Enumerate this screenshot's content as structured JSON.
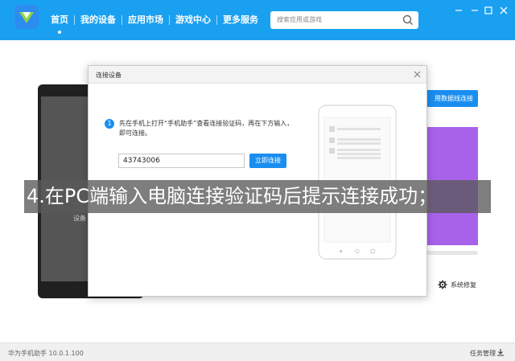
{
  "app": {
    "nav": [
      "首页",
      "我的设备",
      "应用市场",
      "游戏中心",
      "更多服务"
    ],
    "active_nav_index": 0,
    "search_placeholder": "搜索应用或游戏",
    "version": "华为手机助手 10.0.1.100",
    "task_manager": "任务管理"
  },
  "background": {
    "phone_caption": "设备",
    "usb_button": "用数据线连接",
    "repair_label": "系统修复"
  },
  "dialog": {
    "title": "连接设备",
    "step_number": "1",
    "instruction": "先在手机上打开“手机助手”查看连接验证码，再在下方输入，即可连接。",
    "code_value": "43743006",
    "connect_button": "立即连接"
  },
  "caption": "4.在PC端输入电脑连接验证码后提示连接成功；",
  "colors": {
    "brand_blue": "#1aa0f0",
    "button_blue": "#1a8ef0",
    "purple": "#a862ea"
  }
}
